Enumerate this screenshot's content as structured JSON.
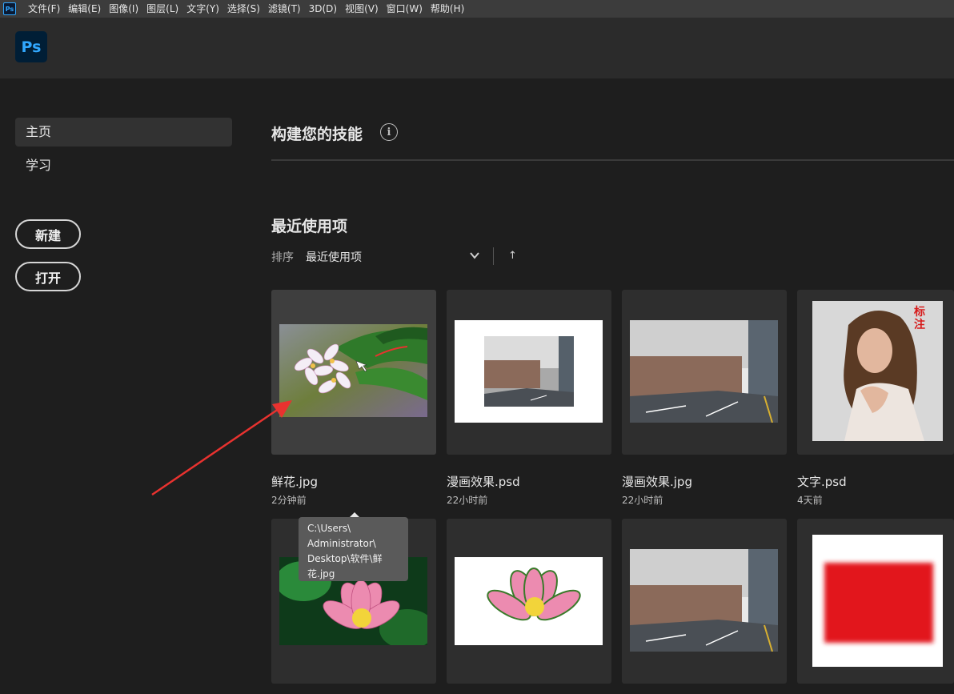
{
  "menubar": {
    "items": [
      "文件(F)",
      "编辑(E)",
      "图像(I)",
      "图层(L)",
      "文字(Y)",
      "选择(S)",
      "滤镜(T)",
      "3D(D)",
      "视图(V)",
      "窗口(W)",
      "帮助(H)"
    ]
  },
  "app": {
    "logo_text": "Ps",
    "mini_logo_text": "Ps"
  },
  "sidebar": {
    "nav": [
      {
        "label": "主页",
        "active": true
      },
      {
        "label": "学习",
        "active": false
      }
    ],
    "new_button": "新建",
    "open_button": "打开"
  },
  "main": {
    "skills_title": "构建您的技能",
    "info_icon": "i",
    "recent_title": "最近使用项",
    "sort_label": "排序",
    "sort_value": "最近使用项",
    "sort_direction_icon": "↑"
  },
  "recent_files": [
    {
      "name": "鲜花.jpg",
      "time": "2分钟前",
      "icon": "flower-photo"
    },
    {
      "name": "漫画效果.psd",
      "time": "22小时前",
      "icon": "street-photo-on-white"
    },
    {
      "name": "漫画效果.jpg",
      "time": "22小时前",
      "icon": "street-photo"
    },
    {
      "name": "文字.psd",
      "time": "4天前",
      "icon": "portrait-photo"
    },
    {
      "name": "",
      "time": "",
      "icon": "lotus-photo"
    },
    {
      "name": "",
      "time": "",
      "icon": "lotus-cutout"
    },
    {
      "name": "",
      "time": "",
      "icon": "street-photo"
    },
    {
      "name": "",
      "time": "",
      "icon": "red-square"
    }
  ],
  "portrait_stamp": "标注",
  "tooltip": {
    "lines": [
      "C:\\Users\\",
      "Administrator\\",
      "Desktop\\软件\\鲜",
      "花.jpg"
    ]
  },
  "colors": {
    "accent": "#31a8ff",
    "annotation_arrow": "#e8322f",
    "background": "#1e1e1e"
  }
}
